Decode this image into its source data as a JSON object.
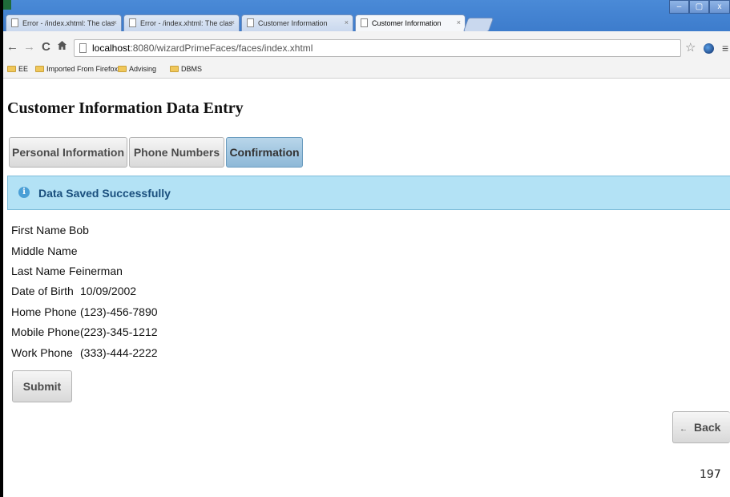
{
  "browser": {
    "tabs": [
      {
        "title": "Error - /index.xhtml: The clas"
      },
      {
        "title": "Error - /index.xhtml: The clas"
      },
      {
        "title": "Customer Information"
      },
      {
        "title": "Customer Information"
      }
    ],
    "tab_close_glyph": "×",
    "window_controls": [
      "–",
      "▢",
      "x"
    ],
    "url_host": "localhost",
    "url_path": ":8080/wizardPrimeFaces/faces/index.xhtml",
    "bookmarks": [
      "EE",
      "Imported From Firefox",
      "Advising",
      "DBMS"
    ],
    "icons": {
      "back": "←",
      "forward": "→",
      "reload": "C",
      "home": "🏠",
      "star": "☆",
      "menu": "≡"
    }
  },
  "page": {
    "title": "Customer Information Data Entry",
    "wizard_tabs": [
      {
        "label": "Personal Information",
        "active": false
      },
      {
        "label": "Phone Numbers",
        "active": false
      },
      {
        "label": "Confirmation",
        "active": true
      }
    ],
    "message": {
      "icon": "info-icon",
      "text": "Data Saved Successfully"
    },
    "fields": [
      {
        "label": "First Name",
        "value": "Bob"
      },
      {
        "label": "Middle Name",
        "value": ""
      },
      {
        "label": "Last Name",
        "value": "Feinerman"
      },
      {
        "label": "Date of Birth",
        "value": "10/09/2002"
      },
      {
        "label": "Home Phone",
        "value": "(123)-456-7890"
      },
      {
        "label": "Mobile Phone",
        "value": "(223)-345-1212"
      },
      {
        "label": "Work Phone",
        "value": "(333)-444-2222"
      }
    ],
    "submit_label": "Submit",
    "back_label": "Back",
    "back_arrow": "←"
  },
  "slide_number": "197",
  "colors": {
    "accent": "#b3e2f5",
    "active_tab": "#8db8d7",
    "message_text": "#1a4f7d"
  }
}
